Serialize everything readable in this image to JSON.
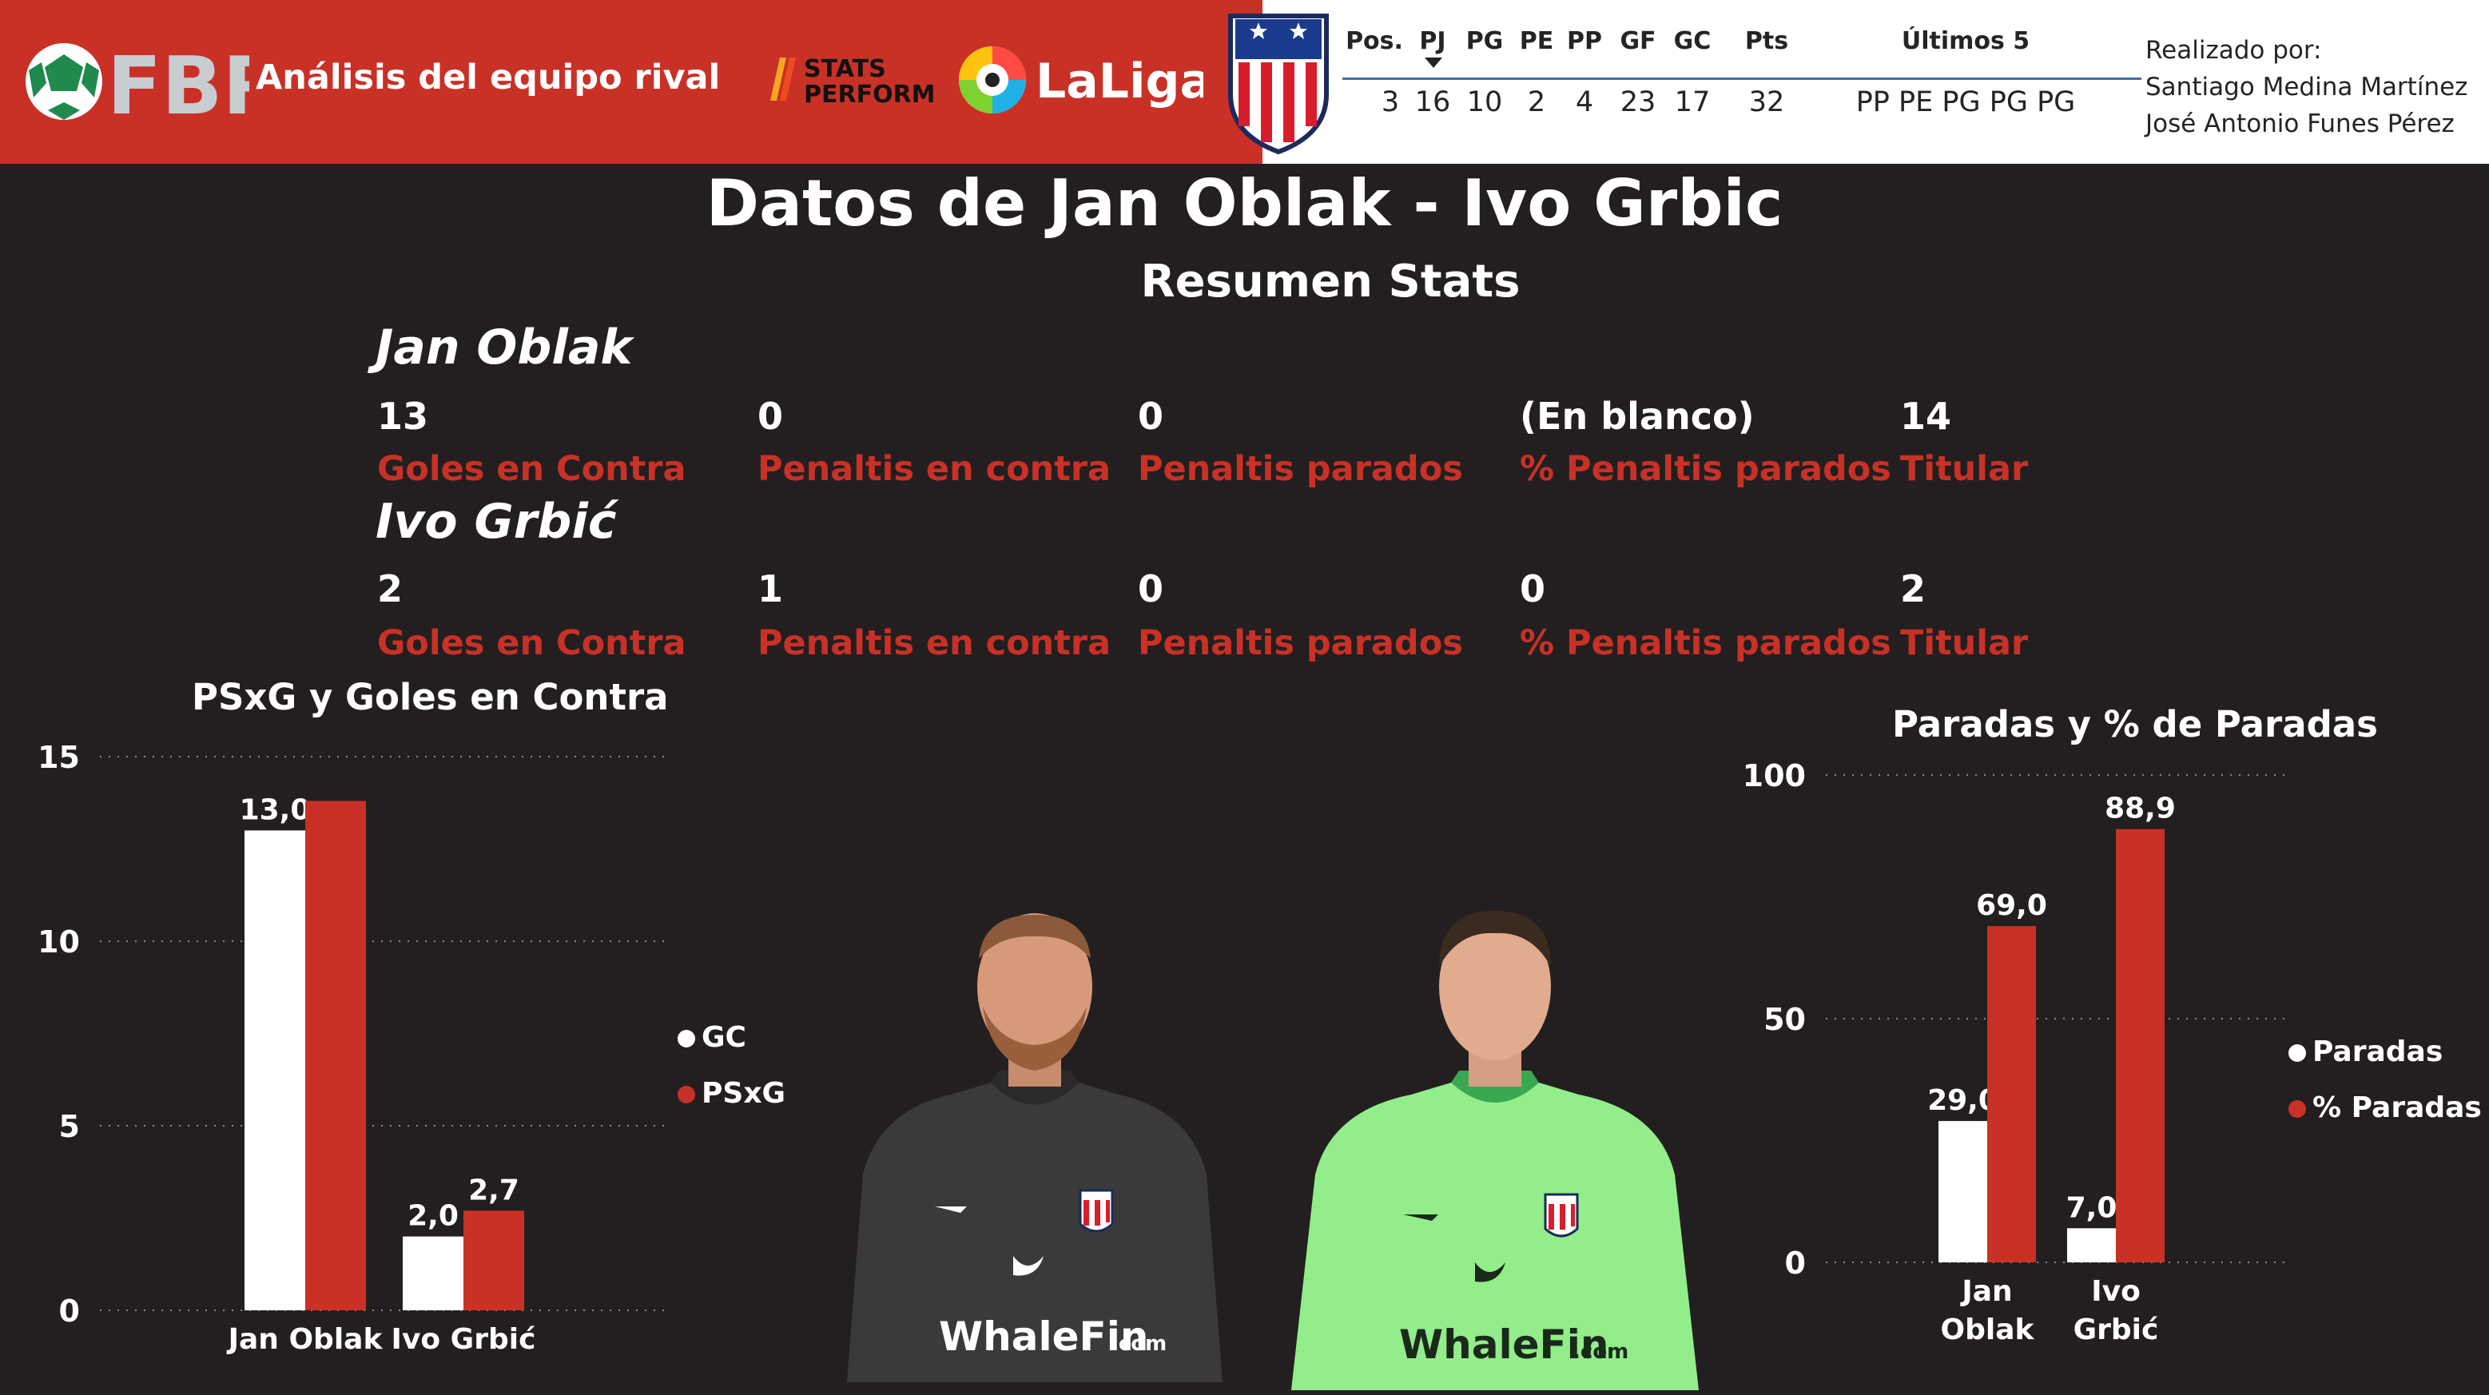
{
  "header": {
    "title": "Análisis del equipo rival",
    "fbref_logo": "FBREF",
    "stats_logo_line1": "STATS",
    "stats_logo_line2": "PERFORM",
    "laliga_logo": "LaLiga",
    "club_crest_icon": "atletico-madrid-crest-icon",
    "colors": {
      "accent_red": "#c93126",
      "background": "#231f20",
      "white": "#ffffff",
      "green_logo": "#1f8a4c"
    }
  },
  "standings": {
    "columns": [
      "Pos.",
      "PJ",
      "PG",
      "PE",
      "PP",
      "GF",
      "GC",
      "Pts",
      "Últimos 5"
    ],
    "values": [
      "3",
      "16",
      "10",
      "2",
      "4",
      "23",
      "17",
      "32",
      "PP PE PG PG PG"
    ]
  },
  "credits": {
    "label": "Realizado por:",
    "author1": "Santiago Medina Martínez",
    "author2": "José Antonio Funes Pérez"
  },
  "page": {
    "title": "Datos de Jan Oblak - Ivo Grbic",
    "section_title": "Resumen Stats"
  },
  "stats": {
    "labels": [
      "Goles en Contra",
      "Penaltis en contra",
      "Penaltis parados",
      "% Penaltis parados",
      "Titular"
    ],
    "players": [
      {
        "name": "Jan Oblak",
        "values": [
          "13",
          "0",
          "0",
          "(En blanco)",
          "14"
        ]
      },
      {
        "name": "Ivo Grbić",
        "values": [
          "2",
          "1",
          "0",
          "0",
          "2"
        ]
      }
    ]
  },
  "chart_data": [
    {
      "type": "bar",
      "title": "PSxG y Goles en Contra",
      "categories": [
        "Jan Oblak",
        "Ivo Grbić"
      ],
      "series": [
        {
          "name": "GC",
          "values": [
            13.0,
            2.0
          ],
          "labels": [
            "13,0",
            "2,0"
          ],
          "color": "#ffffff"
        },
        {
          "name": "PSxG",
          "values": [
            13.8,
            2.7
          ],
          "labels": [
            "",
            "2,7"
          ],
          "color": "#c93126"
        }
      ],
      "yticks": [
        "0",
        "5",
        "10",
        "15"
      ],
      "ylim": [
        0,
        15
      ],
      "grid": true,
      "legend_position": "right"
    },
    {
      "type": "bar",
      "title": "Paradas y % de Paradas",
      "categories": [
        "Jan Oblak",
        "Ivo Grbić"
      ],
      "category_lines": [
        [
          "Jan",
          "Oblak"
        ],
        [
          "Ivo",
          "Grbić"
        ]
      ],
      "series": [
        {
          "name": "Paradas",
          "values": [
            29.0,
            7.0
          ],
          "labels": [
            "29,0",
            "7,0"
          ],
          "color": "#ffffff"
        },
        {
          "name": "% Paradas",
          "values": [
            69.0,
            88.9
          ],
          "labels": [
            "69,0",
            "88,9"
          ],
          "color": "#c93126"
        }
      ],
      "yticks": [
        "0",
        "50",
        "100"
      ],
      "ylim": [
        0,
        100
      ],
      "grid": true,
      "legend_position": "right"
    }
  ],
  "photos": {
    "oblak_icon": "goalkeeper-photo-dark-kit",
    "grbic_icon": "goalkeeper-photo-green-kit",
    "sponsor": "WhaleFin",
    "sponsor_suffix": ".com"
  }
}
